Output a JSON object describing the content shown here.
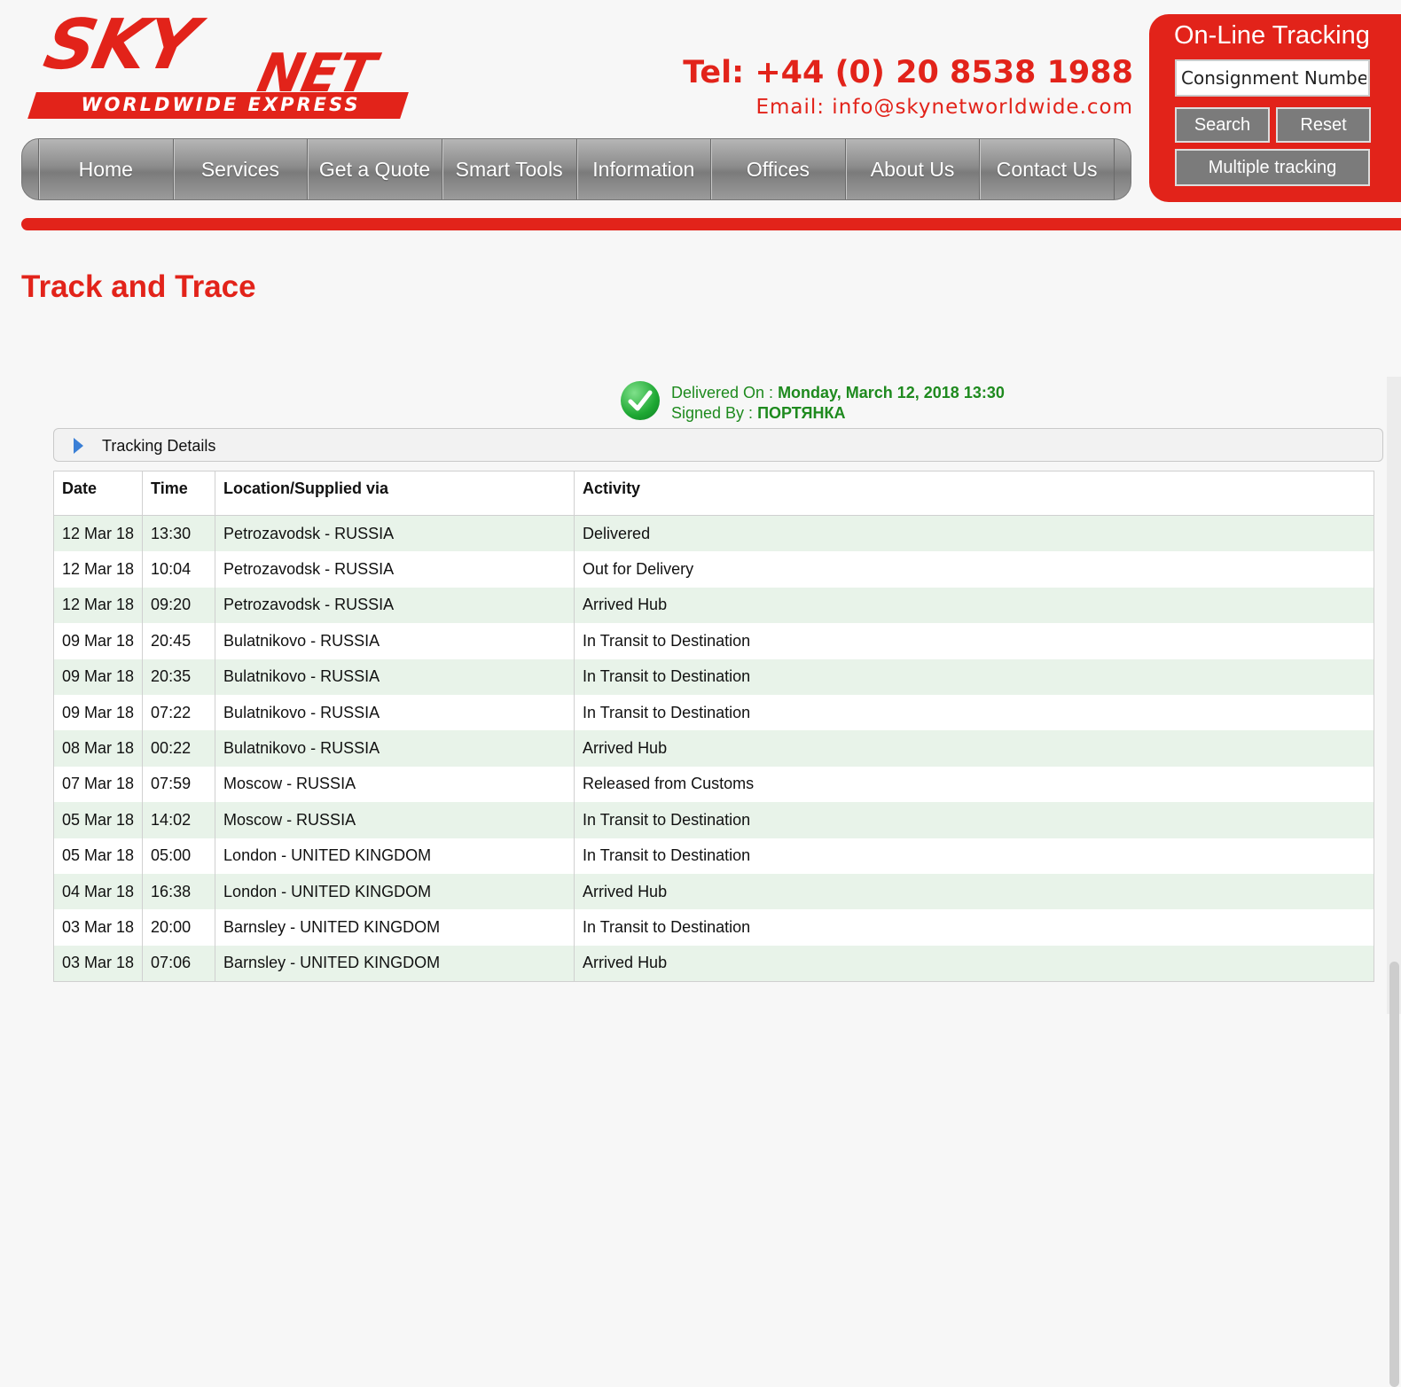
{
  "brand": {
    "name_part1": "SKY",
    "name_part2": "NET",
    "tagline": "WORLDWIDE EXPRESS",
    "color": "#e2231a"
  },
  "contact": {
    "tel": "Tel: +44 (0) 20 8538 1988",
    "email": "Email: info@skynetworldwide.com"
  },
  "nav": {
    "items": [
      "Home",
      "Services",
      "Get a Quote",
      "Smart Tools",
      "Information",
      "Offices",
      "About Us",
      "Contact Us"
    ]
  },
  "tracking_box": {
    "title": "On-Line Tracking",
    "placeholder": "Consignment Number",
    "search_label": "Search",
    "reset_label": "Reset",
    "multiple_label": "Multiple tracking"
  },
  "page_title": "Track and Trace",
  "delivery": {
    "delivered_label": "Delivered On : ",
    "delivered_value": "Monday, March 12, 2018 13:30",
    "signed_label": "Signed By : ",
    "signed_value": "ПОРТЯНКА",
    "icon": "check-circle-icon"
  },
  "details": {
    "label": "Tracking Details",
    "columns": [
      "Date",
      "Time",
      "Location/Supplied via",
      "Activity"
    ],
    "rows": [
      [
        "12 Mar 18",
        "13:30",
        "Petrozavodsk - RUSSIA",
        "Delivered"
      ],
      [
        "12 Mar 18",
        "10:04",
        "Petrozavodsk - RUSSIA",
        "Out for Delivery"
      ],
      [
        "12 Mar 18",
        "09:20",
        "Petrozavodsk - RUSSIA",
        "Arrived Hub"
      ],
      [
        "09 Mar 18",
        "20:45",
        "Bulatnikovo - RUSSIA",
        "In Transit to Destination"
      ],
      [
        "09 Mar 18",
        "20:35",
        "Bulatnikovo - RUSSIA",
        "In Transit to Destination"
      ],
      [
        "09 Mar 18",
        "07:22",
        "Bulatnikovo - RUSSIA",
        "In Transit to Destination"
      ],
      [
        "08 Mar 18",
        "00:22",
        "Bulatnikovo - RUSSIA",
        "Arrived Hub"
      ],
      [
        "07 Mar 18",
        "07:59",
        "Moscow - RUSSIA",
        "Released from Customs"
      ],
      [
        "05 Mar 18",
        "14:02",
        "Moscow - RUSSIA",
        "In Transit to Destination"
      ],
      [
        "05 Mar 18",
        "05:00",
        "London - UNITED KINGDOM",
        "In Transit to Destination"
      ],
      [
        "04 Mar 18",
        "16:38",
        "London - UNITED KINGDOM",
        "Arrived Hub"
      ],
      [
        "03 Mar 18",
        "20:00",
        "Barnsley - UNITED KINGDOM",
        "In Transit to Destination"
      ],
      [
        "03 Mar 18",
        "07:06",
        "Barnsley - UNITED KINGDOM",
        "Arrived Hub"
      ]
    ]
  }
}
